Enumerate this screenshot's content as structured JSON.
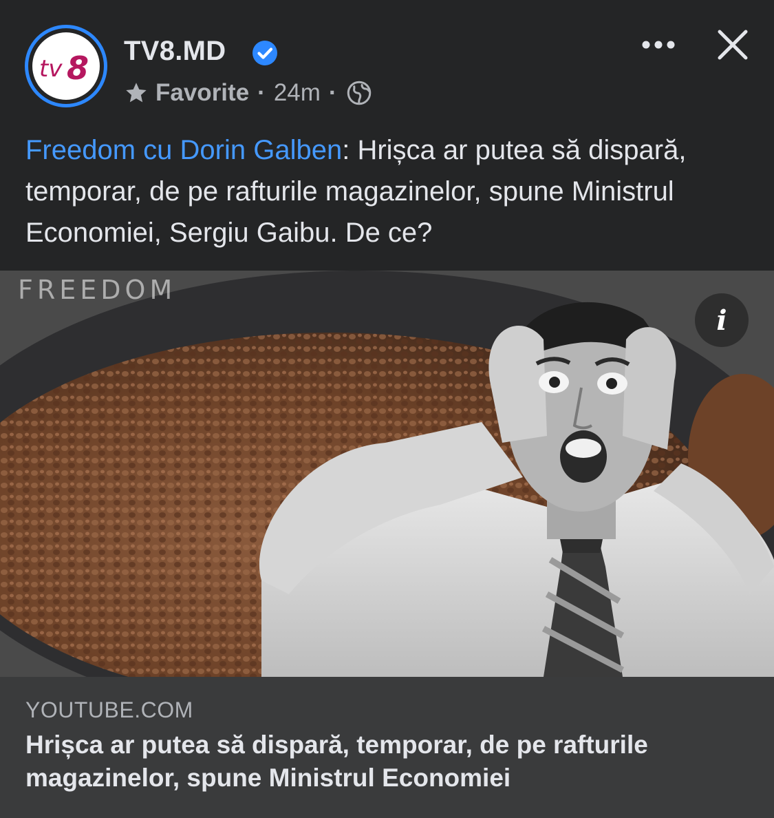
{
  "header": {
    "page_name": "TV8.MD",
    "avatar_logo_text": "tv8",
    "favorite_label": "Favorite",
    "separator": "·",
    "time_ago": "24m",
    "audience_icon": "globe-icon",
    "more_icon": "more-dots-icon",
    "close_icon": "close-icon"
  },
  "caption": {
    "link_text": "Freedom cu Dorin Galben",
    "text": ": Hrișca ar putea să dispară, temporar, de pe rafturile magazinelor, spune Ministrul Economiei, Sergiu Gaibu. De ce?"
  },
  "media": {
    "watermark": "FREEDOM",
    "info_label": "i"
  },
  "link_preview": {
    "domain": "YOUTUBE.COM",
    "title": "Hrișca ar putea să dispară, temporar, de pe rafturile magazinelor, spune Ministrul Economiei"
  },
  "colors": {
    "background": "#242526",
    "link_blue": "#4599ff",
    "verified_blue": "#2d88ff",
    "preview_bg": "#3a3b3c",
    "brand_magenta": "#b5175f"
  }
}
